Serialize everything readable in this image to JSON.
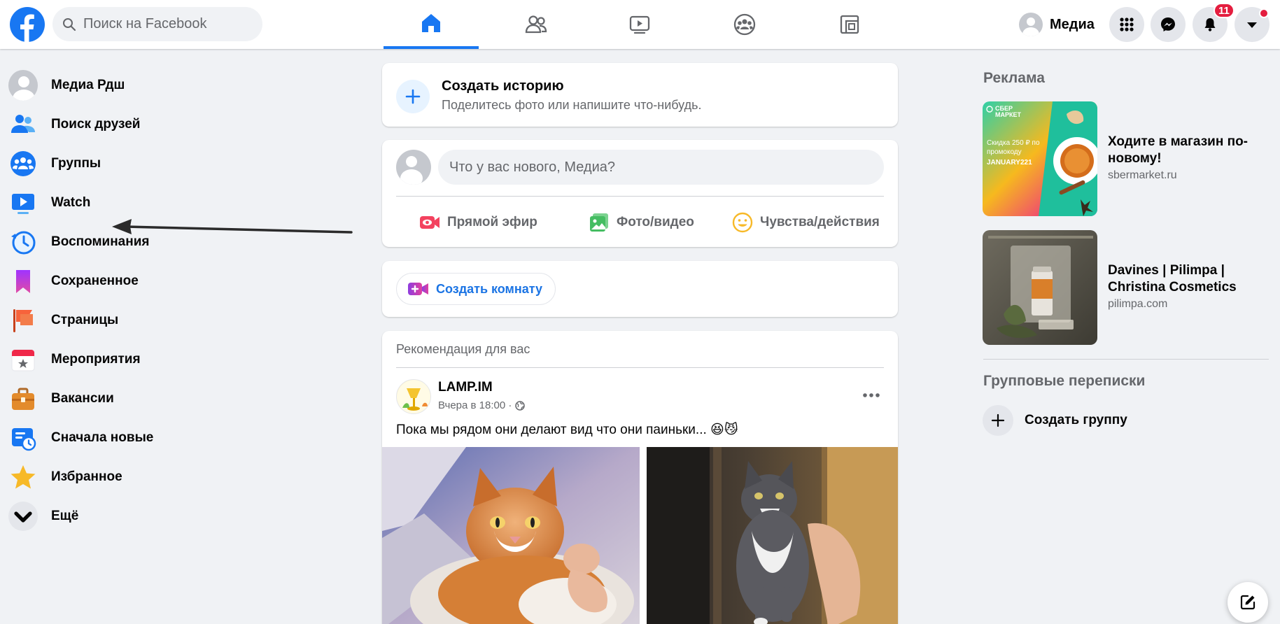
{
  "header": {
    "search_placeholder": "Поиск на Facebook",
    "profile_name": "Медиа",
    "notifications_count": "11",
    "nav_tabs": [
      "home",
      "friends",
      "watch",
      "groups",
      "gaming"
    ],
    "active_tab": "home",
    "accent": "#1877f2"
  },
  "sidebar": {
    "items": [
      {
        "label": "Медиа Рдш",
        "icon": "avatar"
      },
      {
        "label": "Поиск друзей",
        "icon": "friends-icon"
      },
      {
        "label": "Группы",
        "icon": "groups-icon"
      },
      {
        "label": "Watch",
        "icon": "watch-icon"
      },
      {
        "label": "Воспоминания",
        "icon": "memories-icon"
      },
      {
        "label": "Сохраненное",
        "icon": "saved-icon"
      },
      {
        "label": "Страницы",
        "icon": "pages-icon"
      },
      {
        "label": "Мероприятия",
        "icon": "events-icon"
      },
      {
        "label": "Вакансии",
        "icon": "jobs-icon"
      },
      {
        "label": "Сначала новые",
        "icon": "most-recent-icon"
      },
      {
        "label": "Избранное",
        "icon": "favorites-icon"
      },
      {
        "label": "Ещё",
        "icon": "chevron-down-icon"
      }
    ]
  },
  "feed": {
    "story": {
      "title": "Создать историю",
      "subtitle": "Поделитесь фото или напишите что-нибудь."
    },
    "composer": {
      "placeholder": "Что у вас нового, Медиа?",
      "actions": [
        "Прямой эфир",
        "Фото/видео",
        "Чувства/действия"
      ]
    },
    "room": {
      "label": "Создать комнату"
    },
    "recommendation": {
      "heading": "Рекомендация для вас",
      "author": "LAMP.IM",
      "time": "Вчера в 18:00 ·",
      "text": "Пока мы рядом они делают вид что они паиньки... 😆😼"
    }
  },
  "right": {
    "ads_title": "Реклама",
    "ads": [
      {
        "title": "Ходите в магазин по-новому!",
        "url": "sbermarket.ru",
        "brand": "СБЕР МАРКЕТ",
        "promo_text": "Скидка 250 ₽ по промокоду",
        "promo_code": "JANUARY221"
      },
      {
        "title": "Davines | Pilimpa | Christina Cosmetics",
        "url": "pilimpa.com"
      }
    ],
    "group_chats_title": "Групповые переписки",
    "create_group_label": "Создать группу"
  }
}
